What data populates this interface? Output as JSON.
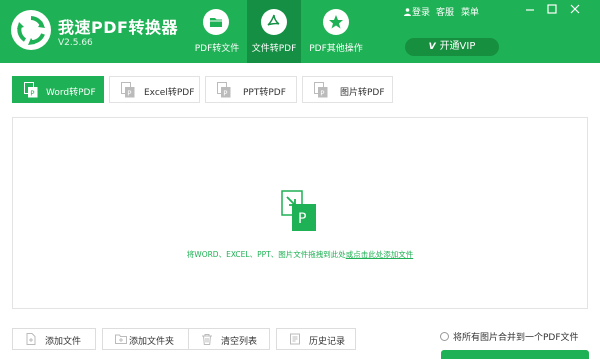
{
  "app": {
    "name": "我速PDF转换器",
    "version": "V2.5.66"
  },
  "nav": {
    "tabs": [
      {
        "label": "PDF转文件",
        "icon": "folder-icon",
        "active": false
      },
      {
        "label": "文件转PDF",
        "icon": "pdf-file-icon",
        "active": true
      },
      {
        "label": "PDF其他操作",
        "icon": "star-icon",
        "active": false
      }
    ]
  },
  "top_links": {
    "login": "登录",
    "service": "客服",
    "menu": "菜单"
  },
  "vip": {
    "label": "开通VIP",
    "icon": "vip-icon",
    "icon_text": "V"
  },
  "subtabs": [
    {
      "label": "Word转PDF",
      "active": true
    },
    {
      "label": "Excel转PDF",
      "active": false
    },
    {
      "label": "PPT转PDF",
      "active": false
    },
    {
      "label": "图片转PDF",
      "active": false
    }
  ],
  "drop_area": {
    "icon_letter": "P",
    "text_before": "将WORD、EXCEL、PPT、图片文件拖拽到此处",
    "text_link": "或点击此处添加文件"
  },
  "bottom": {
    "add_file": "添加文件",
    "add_folder": "添加文件夹",
    "clear_list": "清空列表",
    "history": "历史记录",
    "merge_option": "将所有图片合并到一个PDF文件",
    "merge_checked": false
  },
  "colors": {
    "brand": "#1fb155",
    "brand_dark": "#148f43",
    "vip_bg": "#16903f",
    "border": "#e3e3e3"
  }
}
